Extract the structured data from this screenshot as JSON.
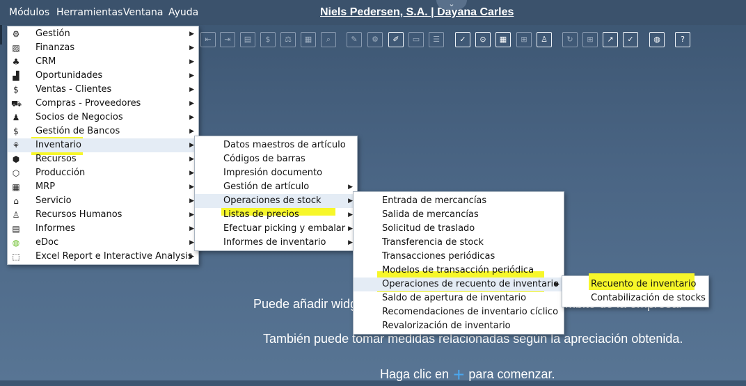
{
  "menubar": {
    "items": [
      "Módulos",
      "Herramientas",
      "Ventana",
      "Ayuda"
    ],
    "title": "Niels Pedersen, S.A. | Dayana Carles"
  },
  "toolbar": {
    "icons": [
      "first-record-icon",
      "previous-record-icon",
      "print-preview-icon",
      "currency-icon",
      "balance-icon",
      "grid-icon",
      "search-records-icon",
      "edit-icon",
      "settings-icon",
      "document-edit-icon",
      "message-icon",
      "forum-icon",
      "calculator-icon",
      "filter-icon",
      "spreadsheet-icon",
      "hierarchy-icon",
      "user-icon",
      "refresh-icon",
      "layout-icon",
      "chart-icon",
      "analytics-icon",
      "browser-icon",
      "help-icon"
    ]
  },
  "modules_menu": {
    "items": [
      {
        "label": "Gestión",
        "icon": "gear-icon"
      },
      {
        "label": "Finanzas",
        "icon": "finance-icon"
      },
      {
        "label": "CRM",
        "icon": "crm-icon"
      },
      {
        "label": "Oportunidades",
        "icon": "opportunities-icon"
      },
      {
        "label": "Ventas - Clientes",
        "icon": "sales-icon"
      },
      {
        "label": "Compras - Proveedores",
        "icon": "cart-icon"
      },
      {
        "label": "Socios de Negocios",
        "icon": "partners-icon"
      },
      {
        "label": "Gestión de Bancos",
        "icon": "bank-icon"
      },
      {
        "label": "Inventario",
        "icon": "inventory-icon"
      },
      {
        "label": "Recursos",
        "icon": "resources-icon"
      },
      {
        "label": "Producción",
        "icon": "production-icon"
      },
      {
        "label": "MRP",
        "icon": "calendar-icon"
      },
      {
        "label": "Servicio",
        "icon": "service-icon"
      },
      {
        "label": "Recursos Humanos",
        "icon": "person-icon"
      },
      {
        "label": "Informes",
        "icon": "reports-icon"
      },
      {
        "label": "eDoc",
        "icon": "edoc-icon"
      },
      {
        "label": "Excel Report e Interactive Analysis",
        "icon": "excel-report-icon"
      }
    ]
  },
  "inventario_menu": {
    "items": [
      {
        "label": "Datos maestros de artículo"
      },
      {
        "label": "Códigos de barras"
      },
      {
        "label": "Impresión documento"
      },
      {
        "label": "Gestión de artículo"
      },
      {
        "label": "Operaciones de stock"
      },
      {
        "label": "Listas de precios"
      },
      {
        "label": "Efectuar picking y embalar"
      },
      {
        "label": "Informes de inventario"
      }
    ]
  },
  "stock_menu": {
    "items": [
      {
        "label": "Entrada de mercancías"
      },
      {
        "label": "Salida de mercancías"
      },
      {
        "label": "Solicitud de traslado"
      },
      {
        "label": "Transferencia de stock"
      },
      {
        "label": "Transacciones periódicas"
      },
      {
        "label": "Modelos de transacción periódica"
      },
      {
        "label": "Operaciones de recuento de inventario"
      },
      {
        "label": "Saldo de apertura de inventario"
      },
      {
        "label": "Recomendaciones de inventario cíclico"
      },
      {
        "label": "Revalorización de inventario"
      }
    ]
  },
  "count_menu": {
    "items": [
      {
        "label": "Recuento de inventario"
      },
      {
        "label": "Contabilización de stocks"
      }
    ]
  },
  "canvas": {
    "line1_start": "Puede añadir widg",
    "line1_end": "mbito de la empresa.",
    "line2": "También puede tomar medidas relacionadas según la apreciación obtenida.",
    "line3_before": "Haga clic en",
    "line3_after": "para comenzar."
  },
  "colors": {
    "highlight": "#f7f72a",
    "menubar": "#3b526c",
    "background": "#4a6584",
    "plus": "#4aa7ef"
  }
}
